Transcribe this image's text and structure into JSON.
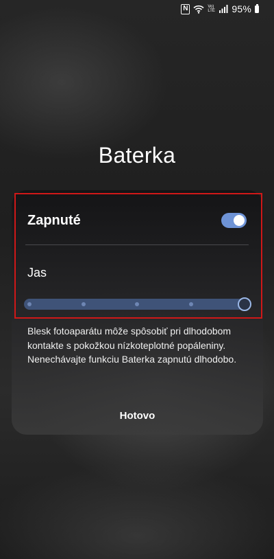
{
  "status_bar": {
    "nfc_icon": "N",
    "volte_icon": "Vo) LTE",
    "battery_percent": "95%",
    "icons": [
      "nfc-icon",
      "wifi-icon",
      "volte-icon",
      "signal-icon",
      "battery-icon"
    ]
  },
  "title": "Baterka",
  "toggle": {
    "label": "Zapnuté",
    "checked": true
  },
  "brightness": {
    "label": "Jas",
    "level": 1.0,
    "steps": 5
  },
  "warning": "Blesk fotoaparátu môže spôsobiť pri dlhodobom kontakte s pokožkou nízkoteplotné popáleniny. Nenechávajte funkciu Baterka zapnutú dlhodobo.",
  "done_label": "Hotovo",
  "colors": {
    "accent": "#6e93d6",
    "slider_track": "#3f5378",
    "highlight_border": "#d01818"
  }
}
